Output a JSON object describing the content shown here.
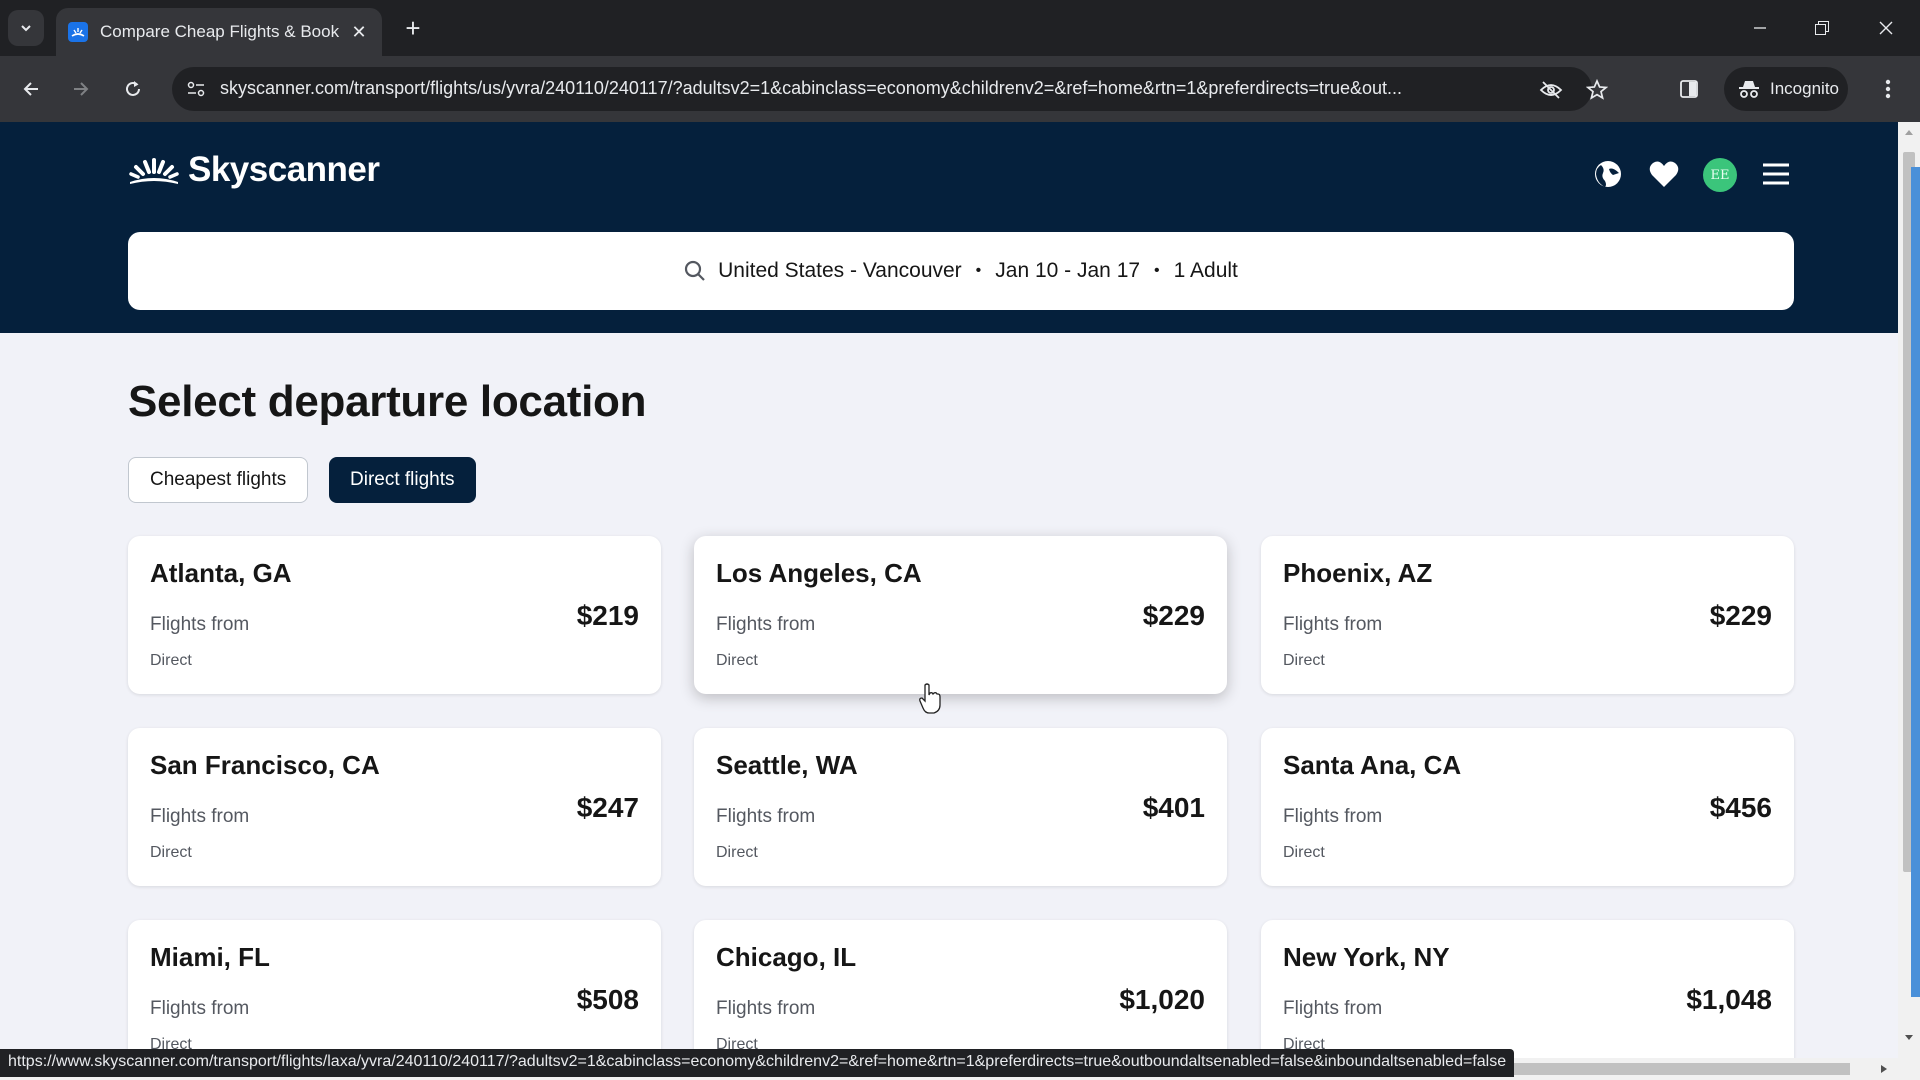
{
  "browser": {
    "tab_title": "Compare Cheap Flights & Book",
    "url": "skyscanner.com/transport/flights/us/yvra/240110/240117/?adultsv2=1&cabinclass=economy&childrenv2=&ref=home&rtn=1&preferdirects=true&out...",
    "incognito_label": "Incognito",
    "status_url": "https://www.skyscanner.com/transport/flights/laxa/yvra/240110/240117/?adultsv2=1&cabinclass=economy&childrenv2=&ref=home&rtn=1&preferdirects=true&outboundaltsenabled=false&inboundaltsenabled=false",
    "icons": [
      "tab-search-icon",
      "skyscanner-favicon",
      "close-tab-icon",
      "new-tab-icon",
      "minimize-icon",
      "restore-icon",
      "close-window-icon",
      "back-icon",
      "forward-icon",
      "reload-icon",
      "site-info-icon",
      "eye-off-icon",
      "bookmark-star-icon",
      "side-panel-icon",
      "incognito-icon",
      "more-menu-icon"
    ]
  },
  "header": {
    "logo_text": "Skyscanner",
    "avatar_initials": "EE",
    "icons": [
      "globe-icon",
      "heart-icon",
      "hamburger-menu-icon"
    ],
    "brand_color": "#05203c",
    "avatar_color": "#3bc57b"
  },
  "search": {
    "route": "United States - Vancouver",
    "dates": "Jan 10 - Jan 17",
    "travellers": "1 Adult",
    "separator": "•"
  },
  "main": {
    "title": "Select departure location",
    "filters": [
      {
        "label": "Cheapest flights",
        "active": false
      },
      {
        "label": "Direct flights",
        "active": true
      }
    ],
    "cards": [
      {
        "city": "Atlanta, GA",
        "label": "Flights from",
        "price": "$219",
        "type": "Direct"
      },
      {
        "city": "Los Angeles, CA",
        "label": "Flights from",
        "price": "$229",
        "type": "Direct"
      },
      {
        "city": "Phoenix, AZ",
        "label": "Flights from",
        "price": "$229",
        "type": "Direct"
      },
      {
        "city": "San Francisco, CA",
        "label": "Flights from",
        "price": "$247",
        "type": "Direct"
      },
      {
        "city": "Seattle, WA",
        "label": "Flights from",
        "price": "$401",
        "type": "Direct"
      },
      {
        "city": "Santa Ana, CA",
        "label": "Flights from",
        "price": "$456",
        "type": "Direct"
      },
      {
        "city": "Miami, FL",
        "label": "Flights from",
        "price": "$508",
        "type": "Direct"
      },
      {
        "city": "Chicago, IL",
        "label": "Flights from",
        "price": "$1,020",
        "type": "Direct"
      },
      {
        "city": "New York, NY",
        "label": "Flights from",
        "price": "$1,048",
        "type": "Direct"
      }
    ]
  }
}
